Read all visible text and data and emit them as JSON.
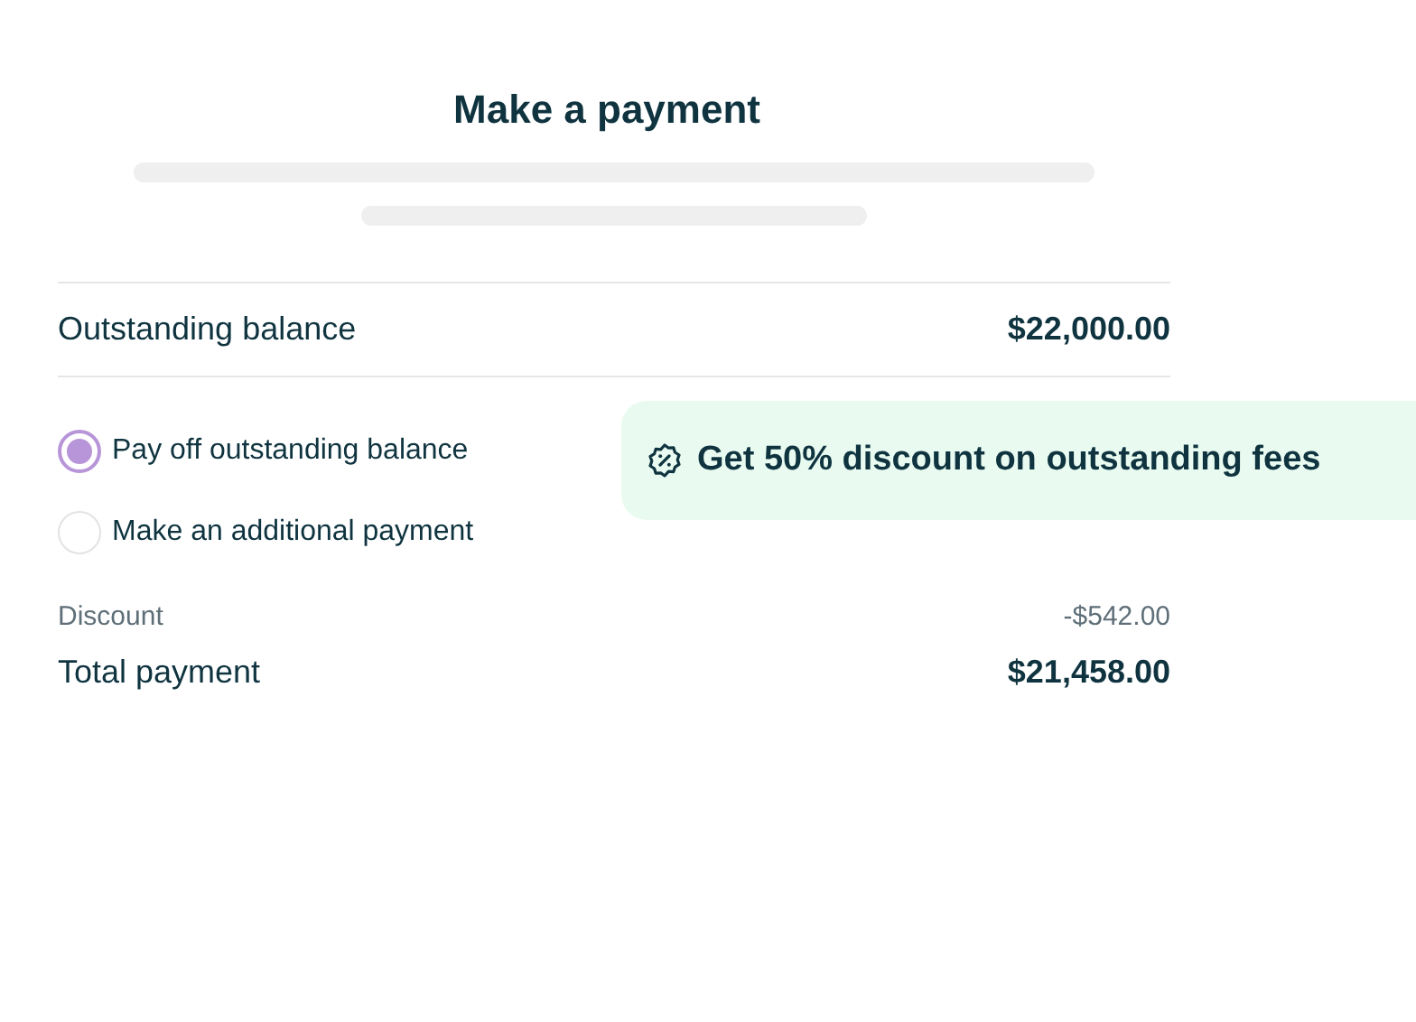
{
  "title": "Make a payment",
  "balance": {
    "label": "Outstanding balance",
    "value": "$22,000.00"
  },
  "options": [
    {
      "label": "Pay off outstanding balance",
      "selected": true
    },
    {
      "label": "Make an additional payment",
      "selected": false
    }
  ],
  "promo": {
    "text": "Get 50% discount on outstanding fees"
  },
  "discount": {
    "label": "Discount",
    "value": "-$542.00"
  },
  "total": {
    "label": "Total payment",
    "value": "$21,458.00"
  }
}
